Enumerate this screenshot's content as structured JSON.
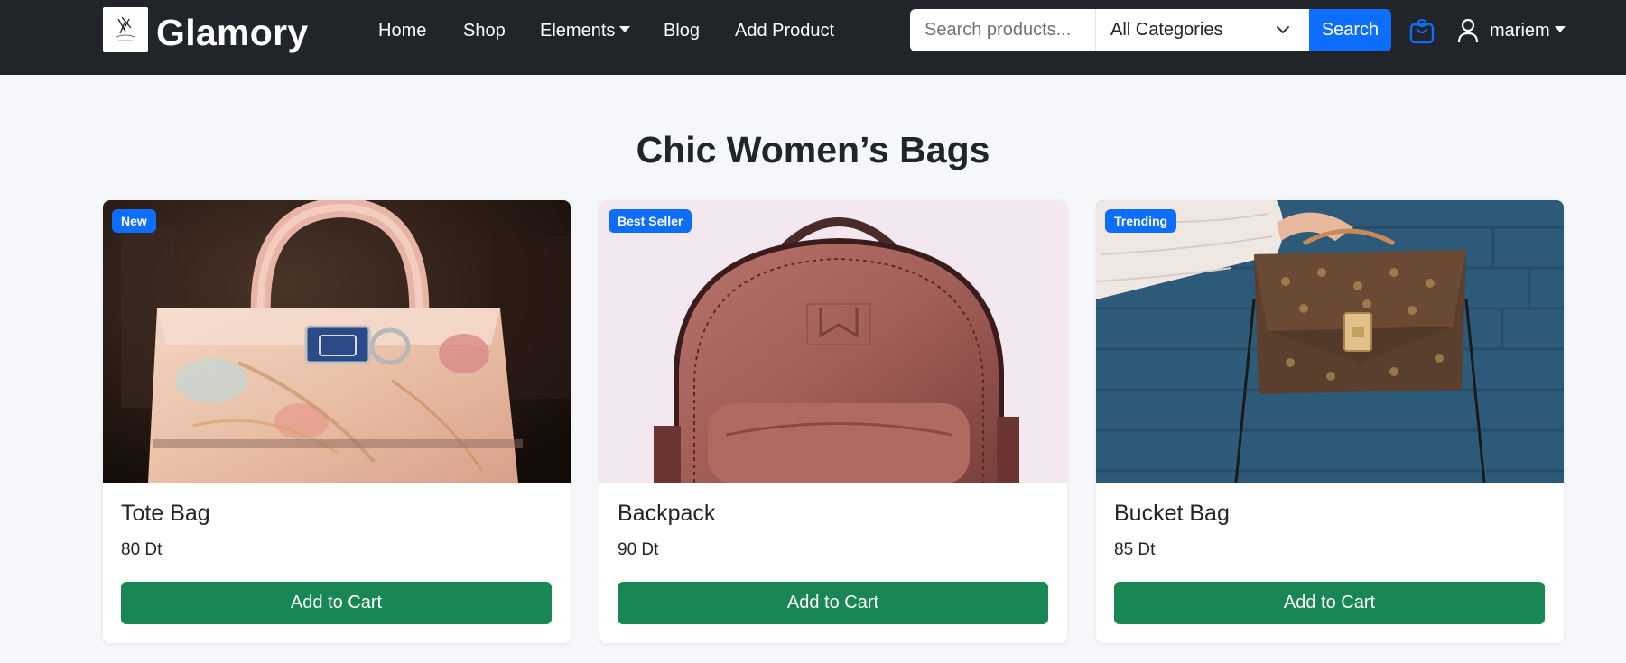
{
  "brand": {
    "name": "Glamory"
  },
  "nav": {
    "home": "Home",
    "shop": "Shop",
    "elements": "Elements",
    "blog": "Blog",
    "add_product": "Add Product"
  },
  "search": {
    "placeholder": "Search products...",
    "category_selected": "All Categories",
    "button_label": "Search"
  },
  "user": {
    "name": "mariem"
  },
  "page": {
    "title": "Chic Women’s Bags"
  },
  "products": [
    {
      "badge": "New",
      "title": "Tote Bag",
      "price": "80 Dt",
      "button": "Add to Cart"
    },
    {
      "badge": "Best Seller",
      "title": "Backpack",
      "price": "90 Dt",
      "button": "Add to Cart"
    },
    {
      "badge": "Trending",
      "title": "Bucket Bag",
      "price": "85 Dt",
      "button": "Add to Cart"
    }
  ],
  "colors": {
    "navbar_bg": "#212529",
    "primary": "#0d6efd",
    "success": "#198754",
    "page_bg": "#f5f7fa"
  },
  "icons": {
    "cart": "shopping-bag-icon",
    "user": "person-icon",
    "select": "chevron-down-icon"
  }
}
